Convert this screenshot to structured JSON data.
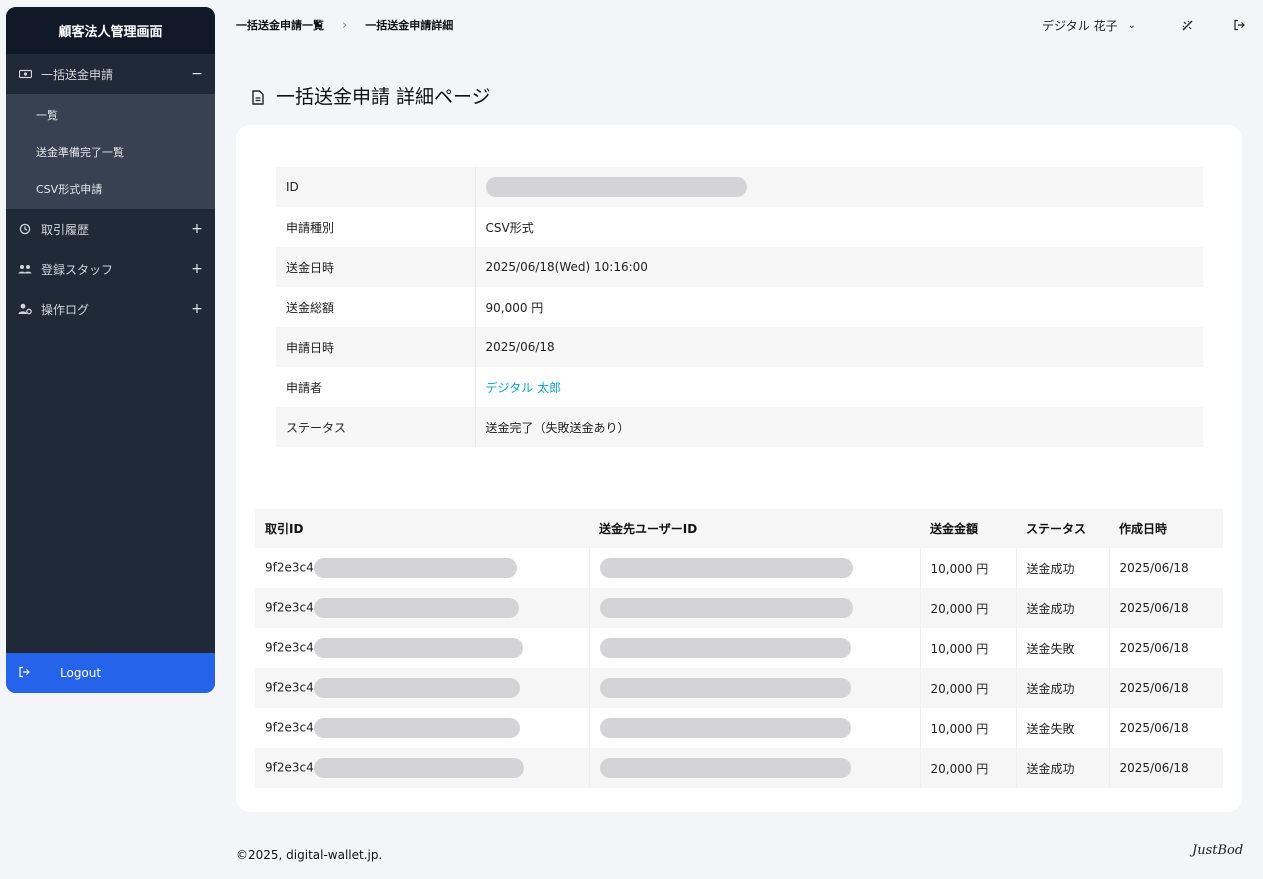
{
  "sidebar": {
    "title": "顧客法人管理画面",
    "sections": [
      {
        "label": "一括送金申請",
        "toggle": "−",
        "icon": "money-icon"
      },
      {
        "label": "取引履歴",
        "toggle": "+",
        "icon": "history-icon"
      },
      {
        "label": "登録スタッフ",
        "toggle": "+",
        "icon": "users-icon"
      },
      {
        "label": "操作ログ",
        "toggle": "+",
        "icon": "user-gear-icon"
      }
    ],
    "subitems": [
      "一覧",
      "送金準備完了一覧",
      "CSV形式申請"
    ],
    "logout": "Logout"
  },
  "breadcrumb": [
    "一括送金申請一覧",
    "一括送金申請詳細"
  ],
  "header": {
    "user_name": "デジタル 花子",
    "chevron": "⌄"
  },
  "page_title": "一括送金申請 詳細ページ",
  "detail": [
    {
      "key": "ID",
      "value": ""
    },
    {
      "key": "申請種別",
      "value": "CSV形式"
    },
    {
      "key": "送金日時",
      "value": "2025/06/18(Wed) 10:16:00"
    },
    {
      "key": "送金総額",
      "value": "90,000 円"
    },
    {
      "key": "申請日時",
      "value": "2025/06/18"
    },
    {
      "key": "申請者",
      "value": "デジタル 太郎"
    },
    {
      "key": "ステータス",
      "value": "送金完了（失敗送金あり）"
    }
  ],
  "transactions": {
    "headers": [
      "取引ID",
      "送金先ユーザーID",
      "送金金額",
      "ステータス",
      "作成日時"
    ],
    "rows": [
      {
        "id_prefix": "9f2e3c4",
        "amount": "10,000 円",
        "status": "送金成功",
        "date": "2025/06/18"
      },
      {
        "id_prefix": "9f2e3c4",
        "amount": "20,000 円",
        "status": "送金成功",
        "date": "2025/06/18"
      },
      {
        "id_prefix": "9f2e3c4",
        "amount": "10,000 円",
        "status": "送金失敗",
        "date": "2025/06/18"
      },
      {
        "id_prefix": "9f2e3c4",
        "amount": "20,000 円",
        "status": "送金成功",
        "date": "2025/06/18"
      },
      {
        "id_prefix": "9f2e3c4",
        "amount": "10,000 円",
        "status": "送金失敗",
        "date": "2025/06/18"
      },
      {
        "id_prefix": "9f2e3c4",
        "amount": "20,000 円",
        "status": "送金成功",
        "date": "2025/06/18"
      }
    ]
  },
  "footer": "©2025, digital-wallet.jp.",
  "signature": "JustBod"
}
